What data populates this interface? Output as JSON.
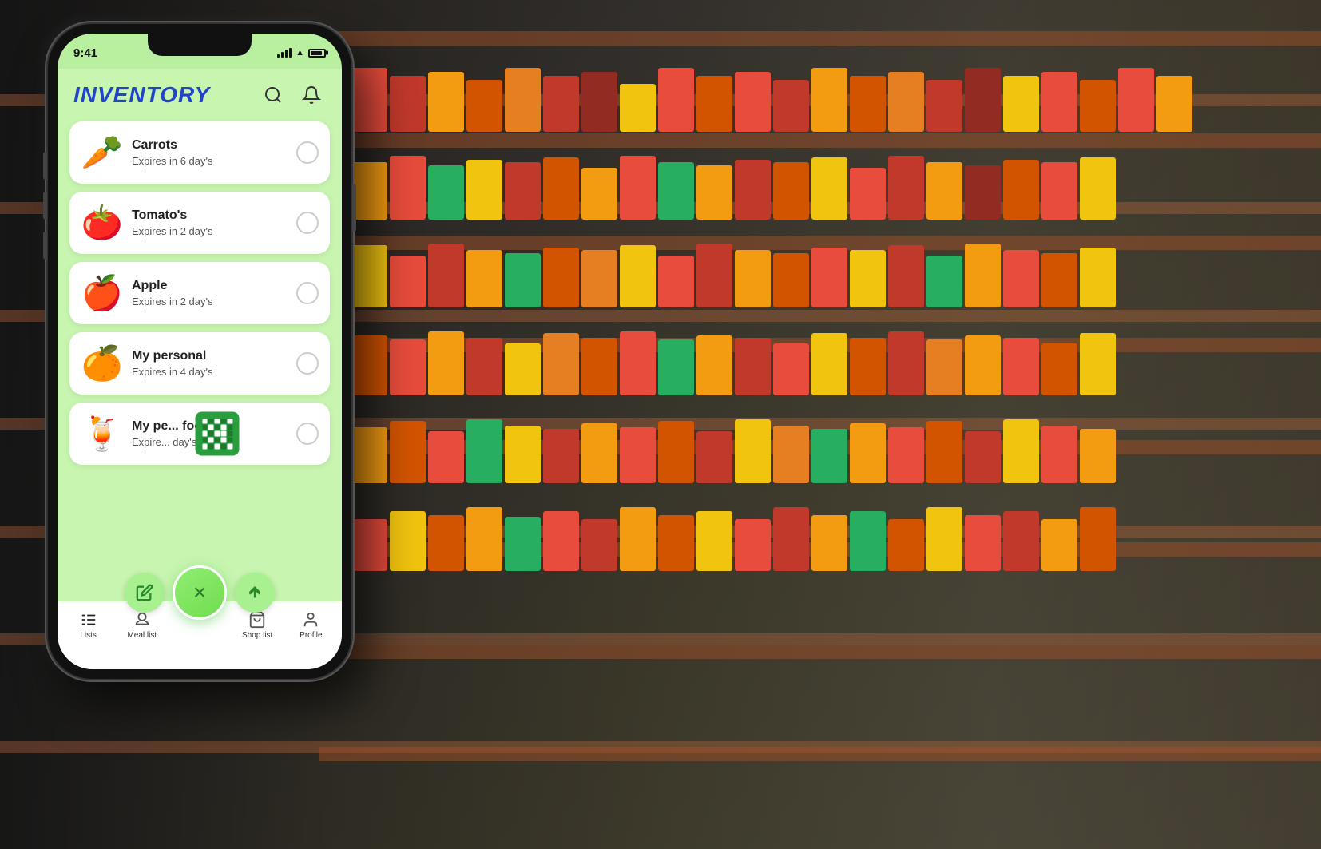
{
  "background": {
    "alt": "Supermarket shelves with colorful packaged goods"
  },
  "phone": {
    "status_bar": {
      "time": "9:41"
    },
    "header": {
      "title": "INVENTORY",
      "search_icon": "search",
      "bell_icon": "bell"
    },
    "inventory_items": [
      {
        "id": 1,
        "emoji": "🥕",
        "name": "Carrots",
        "expires": "Expires in 6 day's",
        "checked": false
      },
      {
        "id": 2,
        "emoji": "🍅",
        "name": "Tomato's",
        "expires": "Expires in 2 day's",
        "checked": false
      },
      {
        "id": 3,
        "emoji": "🍎",
        "name": "Apple",
        "expires": "Expires in 2 day's",
        "checked": false
      },
      {
        "id": 4,
        "emoji": "🍊",
        "name": "My personal",
        "expires": "Expires in 4 day's",
        "checked": false
      },
      {
        "id": 5,
        "emoji": "🍹",
        "name": "My pe... food",
        "expires": "Expire... day's",
        "checked": false,
        "partial": true
      }
    ],
    "fab": {
      "edit_icon": "✎",
      "sort_icon": "⇅",
      "close_icon": "×"
    },
    "bottom_nav": [
      {
        "id": "lists",
        "label": "Lists",
        "icon": "lists",
        "active": true
      },
      {
        "id": "meal-list",
        "label": "Meal list",
        "icon": "meal",
        "active": false
      },
      {
        "id": "shop-list",
        "label": "Shop list",
        "icon": "shop",
        "active": false
      },
      {
        "id": "profile",
        "label": "Profile",
        "icon": "profile",
        "active": false
      }
    ]
  },
  "colors": {
    "app_bg": "#c8f5b0",
    "app_title": "#2244cc",
    "card_bg": "#ffffff",
    "fab_bg": "#90ee70",
    "active_nav": "#222222"
  }
}
